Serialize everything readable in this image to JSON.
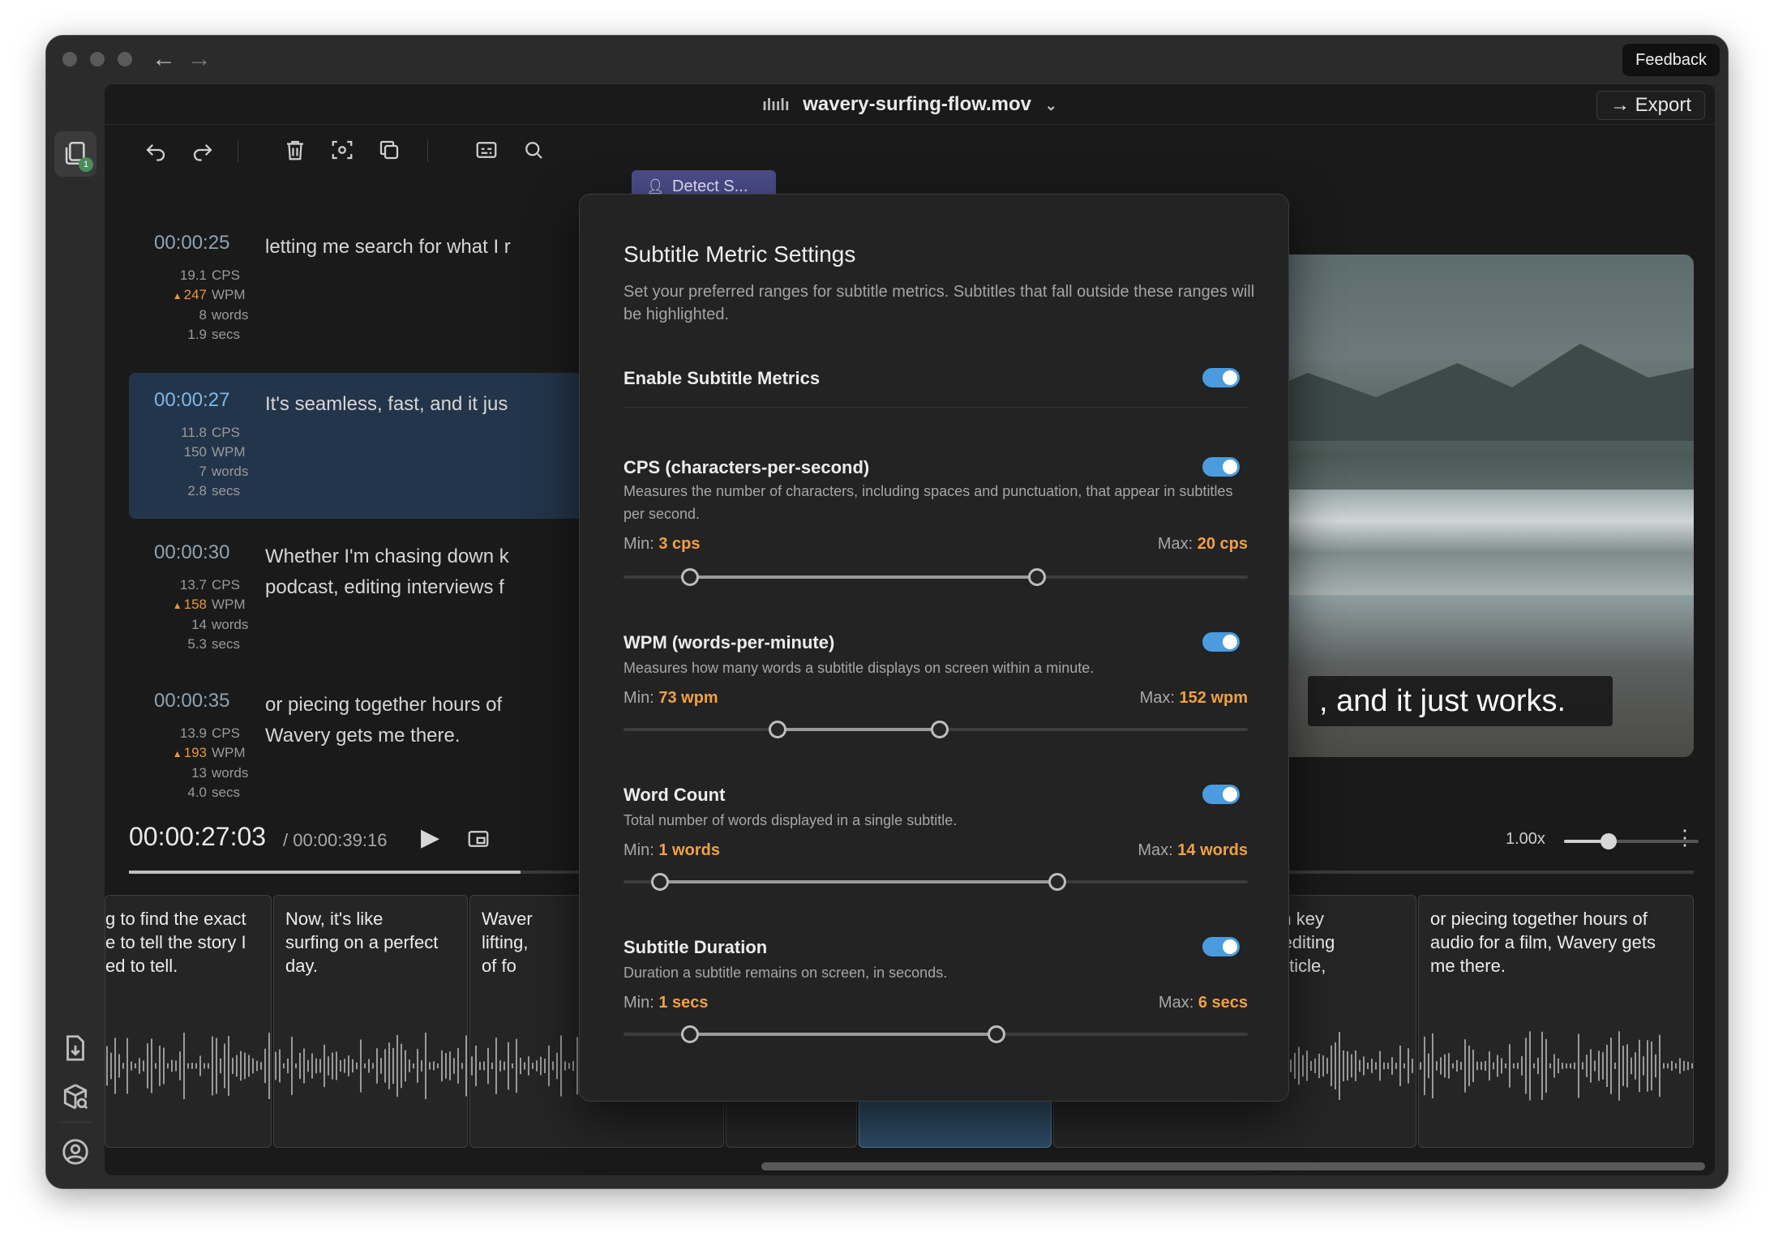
{
  "app": {
    "feedback_label": "Feedback",
    "file_name": "wavery-surfing-flow.mov",
    "export_label": "Export",
    "detect_label": "Detect S...",
    "rail_badge": "1"
  },
  "subtitles": [
    {
      "time": "00:00:25",
      "lines": [
        "letting me search for what I r"
      ],
      "cps": "19.1",
      "wpm": "247",
      "wpm_warn": true,
      "words": "8",
      "secs": "1.9"
    },
    {
      "time": "00:00:27",
      "lines": [
        "It's seamless, fast, and it jus"
      ],
      "cps": "11.8",
      "wpm": "150",
      "wpm_warn": false,
      "words": "7",
      "secs": "2.8"
    },
    {
      "time": "00:00:30",
      "lines": [
        "Whether I'm chasing down k",
        "podcast, editing interviews f"
      ],
      "cps": "13.7",
      "wpm": "158",
      "wpm_warn": true,
      "words": "14",
      "secs": "5.3"
    },
    {
      "time": "00:00:35",
      "lines": [
        "or piecing together hours of",
        "Wavery gets me there."
      ],
      "cps": "13.9",
      "wpm": "193",
      "wpm_warn": true,
      "words": "13",
      "secs": "4.0"
    }
  ],
  "units": {
    "cps": "CPS",
    "wpm": "WPM",
    "words": "words",
    "secs": "secs"
  },
  "video": {
    "caption": ", and it just works."
  },
  "player": {
    "current_time": "00:00:27:03",
    "total_time": "/ 00:00:39:16",
    "speed": "1.00x",
    "speed_level": 0.33,
    "progress": 0.25
  },
  "timeline": {
    "clips": [
      {
        "text": "g to find the exact\ne to tell the story I\ned          to         tell."
      },
      {
        "text": "Now, it's like\nsurfing on a perfect\nday."
      },
      {
        "text": "Waver\nlifting,\nof    fo"
      },
      {
        "text": ""
      },
      {
        "text": ""
      },
      {
        "text": ""
      },
      {
        "text": "down key\nast, editing\nan             article,"
      },
      {
        "text": "or piecing together hours of\naudio for a film, Wavery gets\nme                                    there."
      }
    ]
  },
  "modal": {
    "title": "Subtitle Metric Settings",
    "description": "Set your preferred ranges for subtitle metrics. Subtitles that fall outside these ranges will be highlighted.",
    "enable_label": "Enable Subtitle Metrics",
    "enable_on": true,
    "min_label": "Min:",
    "max_label": "Max:",
    "sections": {
      "cps": {
        "title": "CPS (characters-per-second)",
        "desc": "Measures the number of characters, including spaces and punctuation, that appear in subtitles per second.",
        "min": "3 cps",
        "max": "20 cps",
        "min_pos": 0.106,
        "max_pos": 0.662,
        "on": true
      },
      "wpm": {
        "title": "WPM (words-per-minute)",
        "desc": "Measures how many words a subtitle displays on screen within a minute.",
        "min": "73 wpm",
        "max": "152 wpm",
        "min_pos": 0.247,
        "max_pos": 0.506,
        "on": true
      },
      "words": {
        "title": "Word Count",
        "desc": "Total number of words displayed in a single subtitle.",
        "min": "1 words",
        "max": "14 words",
        "min_pos": 0.058,
        "max_pos": 0.695,
        "on": true
      },
      "duration": {
        "title": "Subtitle Duration",
        "desc": "Duration a subtitle remains on screen, in seconds.",
        "min": "1 secs",
        "max": "6 secs",
        "min_pos": 0.106,
        "max_pos": 0.597,
        "on": true
      }
    }
  },
  "colors": {
    "accent": "#4a9be0",
    "warning": "#e7963a",
    "active_row": "#23354a",
    "detect": "#4b4d8a"
  }
}
